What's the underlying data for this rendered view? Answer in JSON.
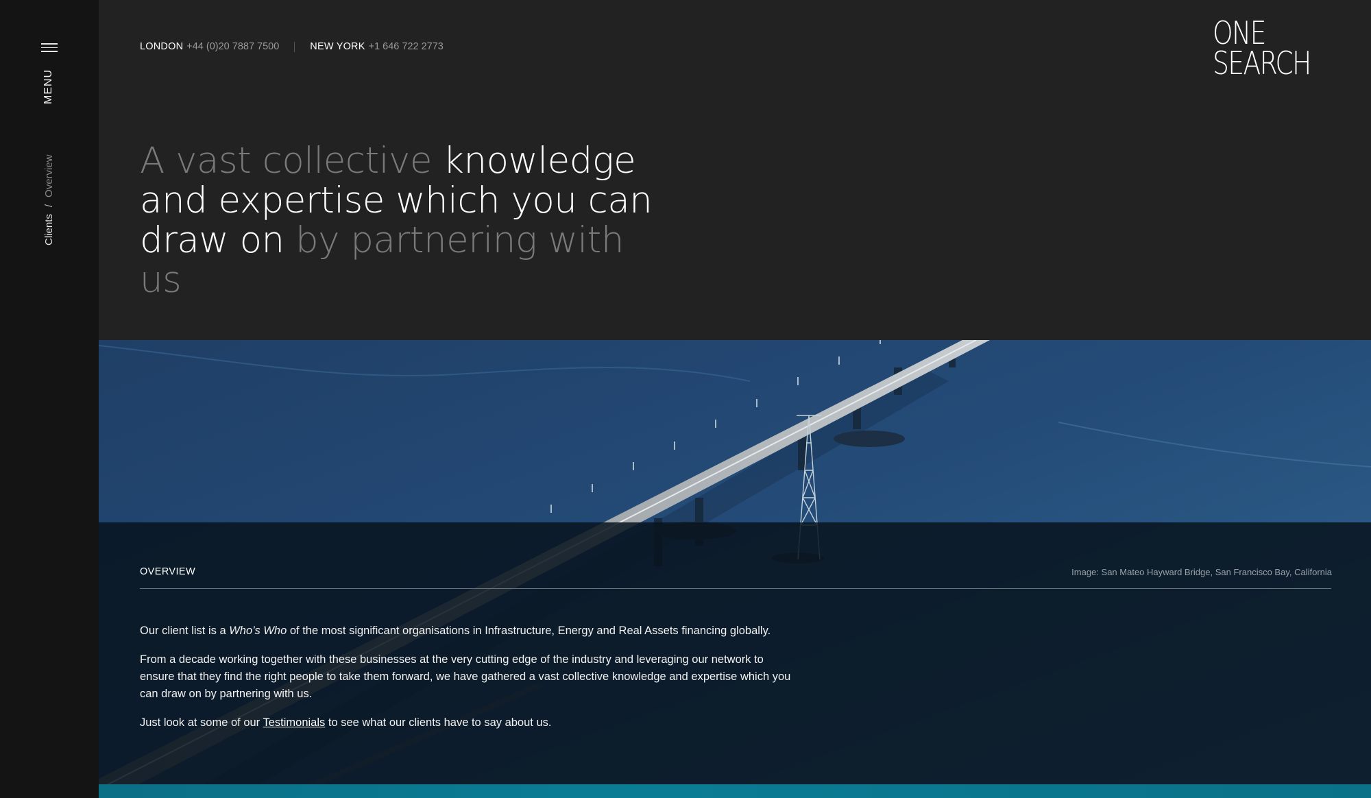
{
  "sidebar": {
    "menu_label": "MENU",
    "breadcrumb": {
      "parent": "Clients",
      "separator": "/",
      "current": "Overview"
    }
  },
  "header": {
    "contacts": [
      {
        "city": "LONDON",
        "phone": "+44 (0)20 7887 7500"
      },
      {
        "city": "NEW YORK",
        "phone": "+1 646 722 2773"
      }
    ],
    "logo": {
      "line1": "ONE",
      "line2": "SEARCH"
    }
  },
  "hero": {
    "dim1": "A vast collective",
    "bright": "knowledge and expertise which you can draw on",
    "dim2": "by partnering with us"
  },
  "overview": {
    "title": "OVERVIEW",
    "image_caption": "Image: San Mateo Hayward Bridge, San Francisco Bay, California",
    "p1_before": "Our client list is a",
    "p1_em": "Who’s Who",
    "p1_after": "of the most significant organisations in Infrastructure, Energy and Real Assets financing globally.",
    "p2": "From a decade working together with these businesses at the very cutting edge of the industry and leveraging our network to ensure that they find the right people to take them forward, we have gathered a vast collective knowledge and expertise which you can draw on by partnering with us.",
    "p3_before": "Just look at some of our",
    "p3_link": "Testimonials",
    "p3_after": "to see what our clients have to say about us."
  },
  "colors": {
    "page_bg": "#222222",
    "sidebar_bg": "#141414",
    "water": "#2b5a86",
    "overlay": "#08141e",
    "accent_teal": "#0a7d95"
  },
  "icons": {
    "menu": "hamburger-icon"
  }
}
